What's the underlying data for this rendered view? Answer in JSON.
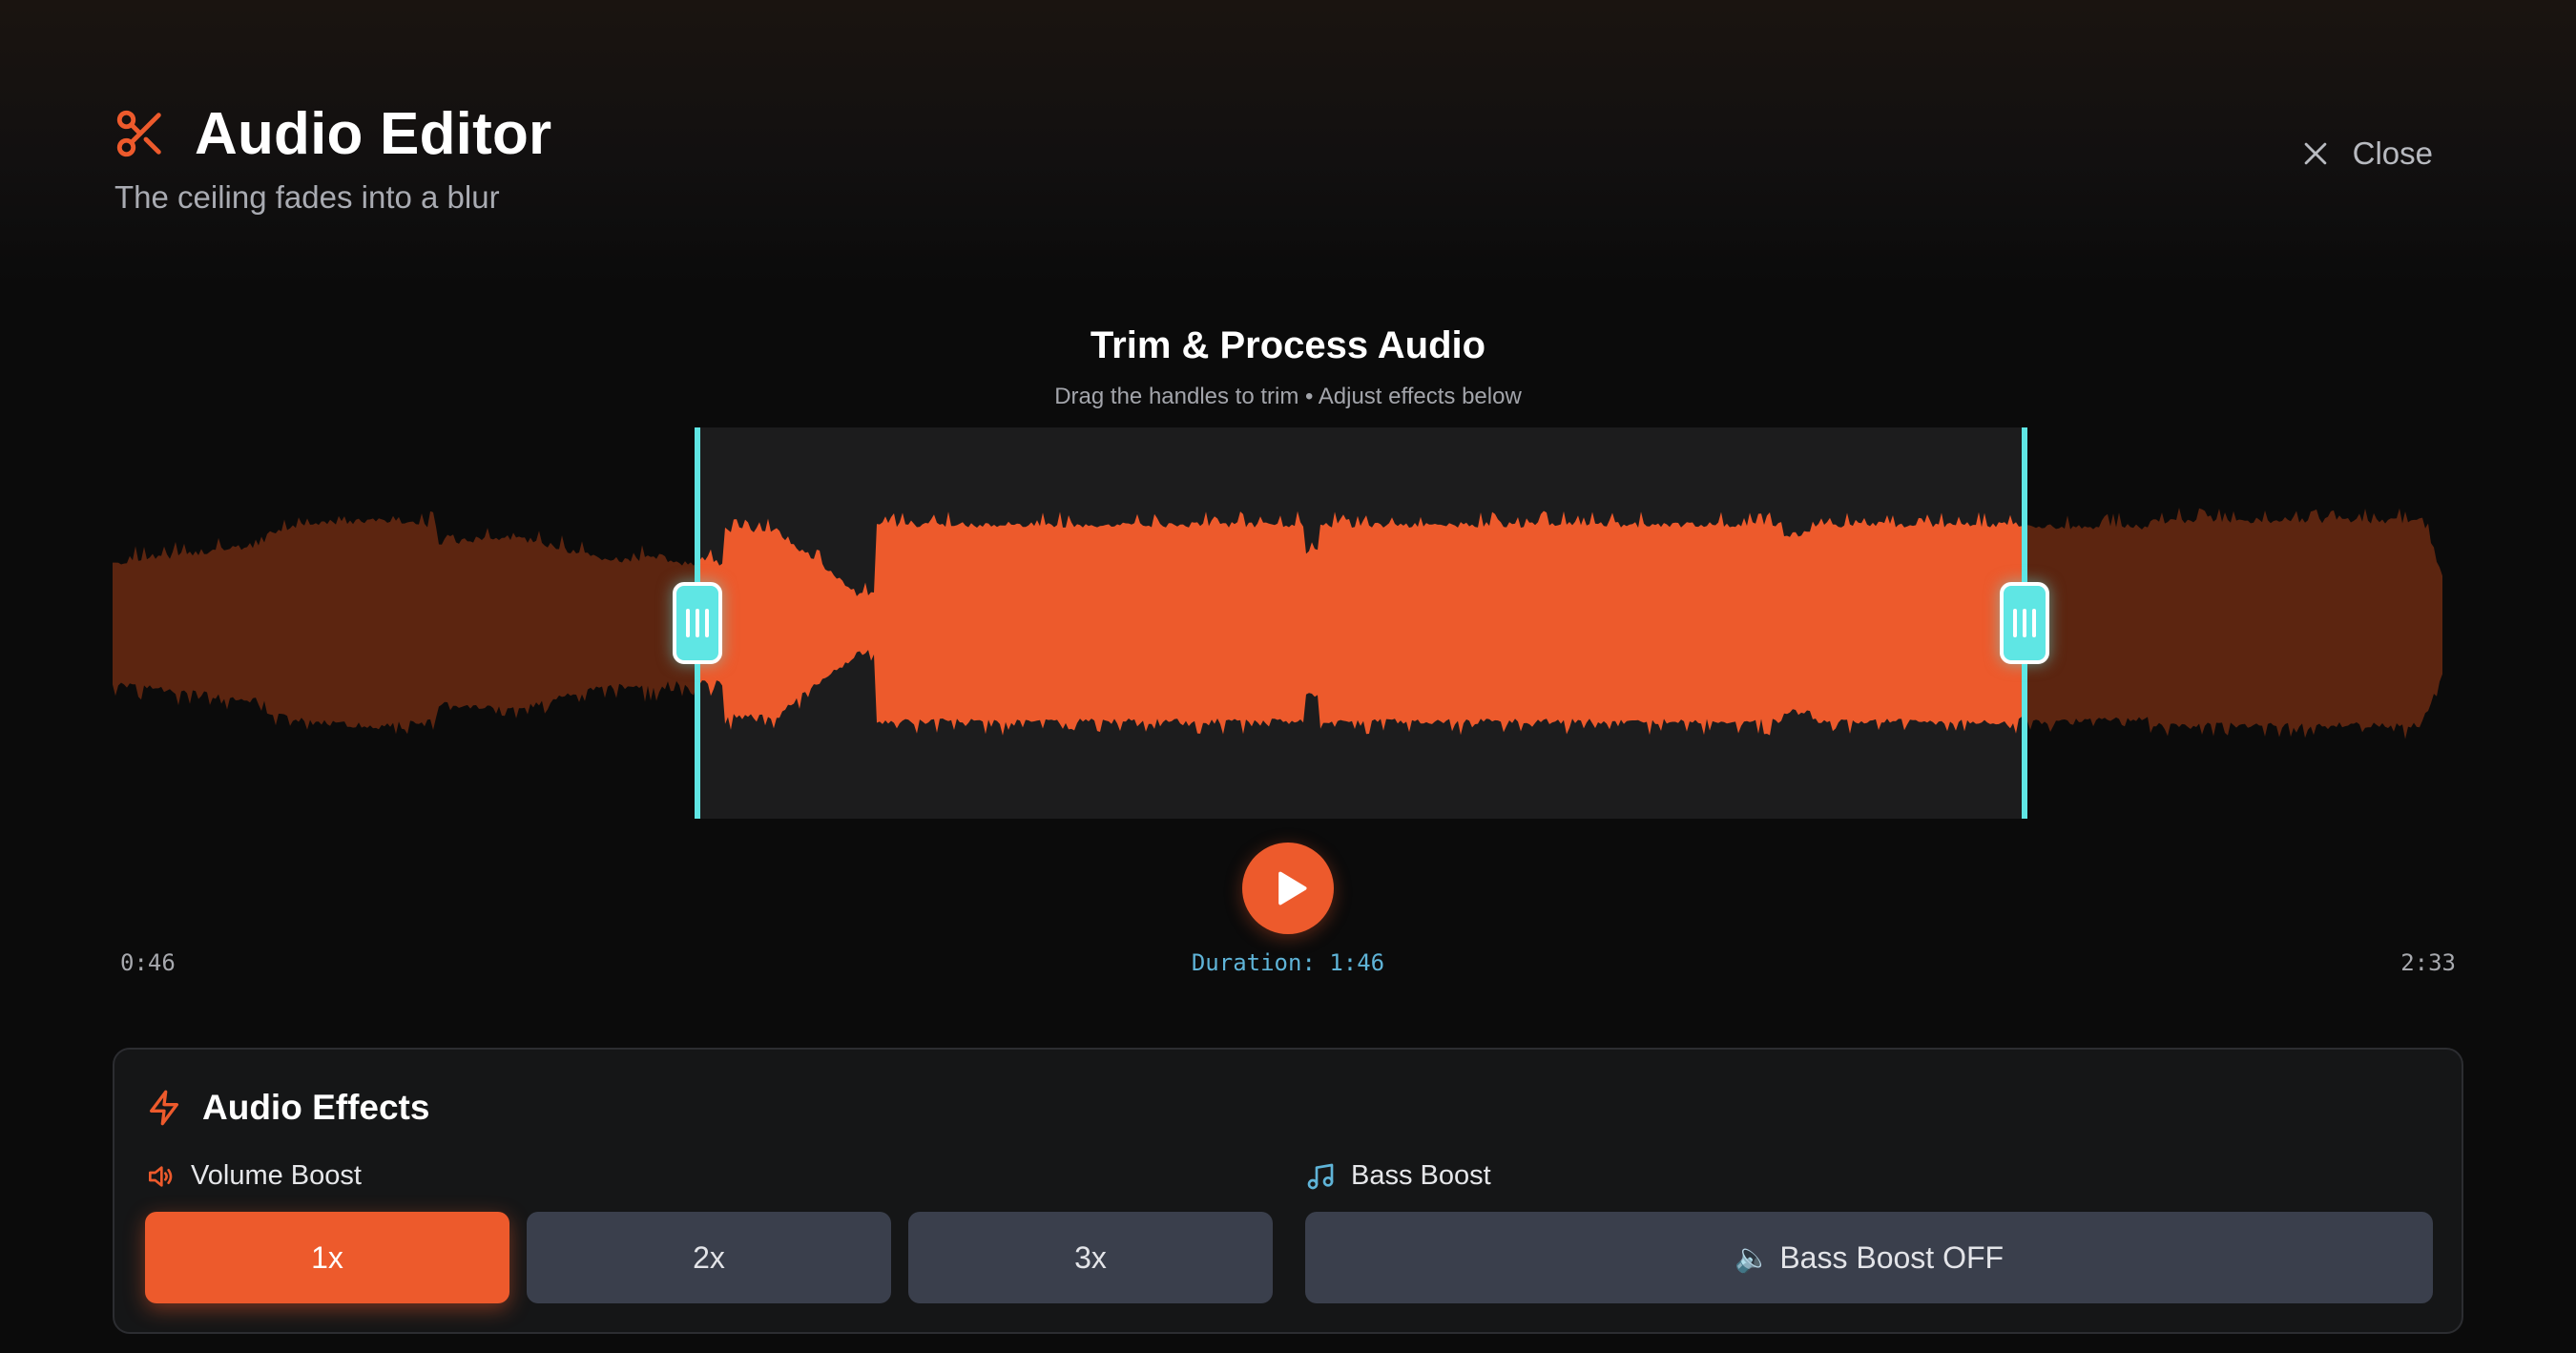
{
  "header": {
    "title": "Audio Editor",
    "subtitle": "The ceiling fades into a blur",
    "close_label": "Close"
  },
  "trim": {
    "title": "Trim & Process Audio",
    "subtitle": "Drag the handles to trim • Adjust effects below",
    "start_time": "0:46",
    "end_time": "2:33",
    "duration_label": "Duration: 1:46",
    "selection_start_fraction": 0.251,
    "selection_end_fraction": 0.82
  },
  "effects": {
    "title": "Audio Effects",
    "volume": {
      "label": "Volume Boost",
      "options": [
        "1x",
        "2x",
        "3x"
      ],
      "selected": "1x"
    },
    "bass": {
      "label": "Bass Boost",
      "button_icon": "🔈",
      "button_label": "Bass Boost OFF",
      "state": "off"
    }
  },
  "icons": {
    "title": "scissors-icon",
    "close": "close-icon",
    "play": "play-icon",
    "effects": "lightning-icon",
    "volume": "speaker-icon",
    "bass": "music-note-icon"
  },
  "colors": {
    "accent": "#ed5a2c",
    "waveform_inactive": "#5c2510",
    "handle": "#5fe6e4",
    "duration_text": "#5fb4d8",
    "bass_icon": "#5fb4d8",
    "button_inactive": "#3a3f4c"
  }
}
